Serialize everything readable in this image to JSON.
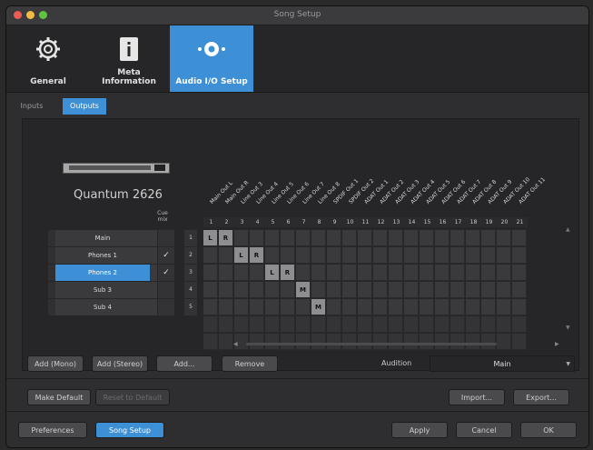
{
  "window": {
    "title": "Song Setup"
  },
  "colors": {
    "accent": "#3d8fd6",
    "close": "#ee5b52",
    "minimize": "#f3bc41",
    "zoom": "#5fc43f"
  },
  "top_tabs": [
    {
      "label": "General",
      "icon": "gear-icon"
    },
    {
      "label": "Meta Information",
      "icon": "info-icon"
    },
    {
      "label": "Audio I/O Setup",
      "icon": "speaker-icon"
    }
  ],
  "sub_tabs": {
    "inputs": "Inputs",
    "outputs": "Outputs"
  },
  "device": {
    "name": "Quantum 2626"
  },
  "cue_header": "Cue mix",
  "channels": [
    "Main Out L",
    "Main Out R",
    "Line Out 3",
    "Line Out 4",
    "Line Out 5",
    "Line Out 6",
    "Line Out 7",
    "Line Out 8",
    "SPDIF Out 1",
    "SPDIF Out 2",
    "ADAT Out 1",
    "ADAT Out 2",
    "ADAT Out 3",
    "ADAT Out 4",
    "ADAT Out 5",
    "ADAT Out 6",
    "ADAT Out 7",
    "ADAT Out 8",
    "ADAT Out 9",
    "ADAT Out 10",
    "ADAT Out 11"
  ],
  "column_numbers": [
    "1",
    "2",
    "3",
    "4",
    "5",
    "6",
    "7",
    "8",
    "9",
    "10",
    "11",
    "12",
    "13",
    "14",
    "15",
    "16",
    "17",
    "18",
    "19",
    "20",
    "21"
  ],
  "outputs": [
    {
      "num": "1",
      "name": "Main",
      "cue": "",
      "selected": false
    },
    {
      "num": "2",
      "name": "Phones 1",
      "cue": "✓",
      "selected": false
    },
    {
      "num": "3",
      "name": "Phones 2",
      "cue": "✓",
      "selected": true
    },
    {
      "num": "4",
      "name": "Sub 3",
      "cue": "",
      "selected": false
    },
    {
      "num": "5",
      "name": "Sub 4",
      "cue": "",
      "selected": false
    }
  ],
  "assignments": [
    {
      "row": 0,
      "col": 0,
      "label": "L"
    },
    {
      "row": 0,
      "col": 1,
      "label": "R"
    },
    {
      "row": 1,
      "col": 2,
      "label": "L"
    },
    {
      "row": 1,
      "col": 3,
      "label": "R"
    },
    {
      "row": 2,
      "col": 4,
      "label": "L"
    },
    {
      "row": 2,
      "col": 5,
      "label": "R"
    },
    {
      "row": 3,
      "col": 6,
      "label": "M"
    },
    {
      "row": 4,
      "col": 7,
      "label": "M"
    }
  ],
  "actions": {
    "add_mono": "Add (Mono)",
    "add_stereo": "Add (Stereo)",
    "add": "Add...",
    "remove": "Remove",
    "audition_label": "Audition",
    "audition_value": "Main"
  },
  "defaults": {
    "make_default": "Make Default",
    "reset_default": "Reset to Default",
    "import": "Import...",
    "export": "Export..."
  },
  "footer": {
    "preferences": "Preferences",
    "song_setup": "Song Setup",
    "apply": "Apply",
    "cancel": "Cancel",
    "ok": "OK"
  }
}
